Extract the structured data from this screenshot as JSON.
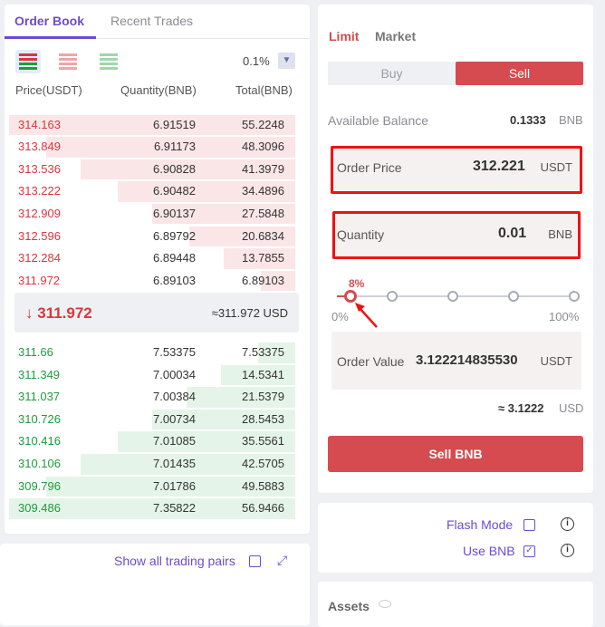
{
  "tabs": [
    {
      "label": "Order Book",
      "active": true
    },
    {
      "label": "Recent Trades",
      "active": false
    }
  ],
  "precision": "0.1%",
  "columns": [
    "Price(USDT)",
    "Quantity(BNB)",
    "Total(BNB)"
  ],
  "asks": [
    {
      "price": "314.163",
      "qty": "6.91519",
      "total": "55.2248",
      "depth": 1.0
    },
    {
      "price": "313.849",
      "qty": "6.91173",
      "total": "48.3096",
      "depth": 0.87
    },
    {
      "price": "313.536",
      "qty": "6.90828",
      "total": "41.3979",
      "depth": 0.75
    },
    {
      "price": "313.222",
      "qty": "6.90482",
      "total": "34.4896",
      "depth": 0.62
    },
    {
      "price": "312.909",
      "qty": "6.90137",
      "total": "27.5848",
      "depth": 0.5
    },
    {
      "price": "312.596",
      "qty": "6.89792",
      "total": "20.6834",
      "depth": 0.37
    },
    {
      "price": "312.284",
      "qty": "6.89448",
      "total": "13.7855",
      "depth": 0.25
    },
    {
      "price": "311.972",
      "qty": "6.89103",
      "total": "6.89103",
      "depth": 0.12
    }
  ],
  "mid": {
    "arrow": "↓",
    "price": "311.972",
    "usd": "≈311.972 USD"
  },
  "bids": [
    {
      "price": "311.66",
      "qty": "7.53375",
      "total": "7.53375",
      "depth": 0.13
    },
    {
      "price": "311.349",
      "qty": "7.00034",
      "total": "14.5341",
      "depth": 0.26
    },
    {
      "price": "311.037",
      "qty": "7.00384",
      "total": "21.5379",
      "depth": 0.38
    },
    {
      "price": "310.726",
      "qty": "7.00734",
      "total": "28.5453",
      "depth": 0.5
    },
    {
      "price": "310.416",
      "qty": "7.01085",
      "total": "35.5561",
      "depth": 0.62
    },
    {
      "price": "310.106",
      "qty": "7.01435",
      "total": "42.5705",
      "depth": 0.75
    },
    {
      "price": "309.796",
      "qty": "7.01786",
      "total": "49.5883",
      "depth": 0.87
    },
    {
      "price": "309.486",
      "qty": "7.35822",
      "total": "56.9466",
      "depth": 1.0
    }
  ],
  "pairs": {
    "show_all_label": "Show all trading pairs"
  },
  "order": {
    "type_tabs": [
      {
        "label": "Limit",
        "active": true
      },
      {
        "label": "Market",
        "active": false
      }
    ],
    "buy_label": "Buy",
    "sell_label": "Sell",
    "balance_label": "Available Balance",
    "balance_value": "0.1333",
    "balance_unit": "BNB",
    "price_label": "Order Price",
    "price_value": "312.221",
    "price_unit": "USDT",
    "qty_label": "Quantity",
    "qty_value": "0.01",
    "qty_unit": "BNB",
    "slider_percent_label": "8%",
    "slider_value": 0.08,
    "slider_min": "0%",
    "slider_max": "100%",
    "value_label": "Order Value",
    "value_value": "3.122214835530",
    "value_unit": "USDT",
    "approx_value": "≈ 3.1222",
    "approx_unit": "USD",
    "submit_label": "Sell BNB"
  },
  "settings": {
    "flash_mode_label": "Flash Mode",
    "flash_mode_checked": false,
    "use_bnb_label": "Use BNB",
    "use_bnb_checked": true
  },
  "assets_label": "Assets",
  "colors": {
    "accent": "#6c4ccf",
    "sell": "#d54b4f",
    "ask_text": "#d9363e",
    "bid_text": "#1e9c3b",
    "highlight": "#ee1313"
  }
}
